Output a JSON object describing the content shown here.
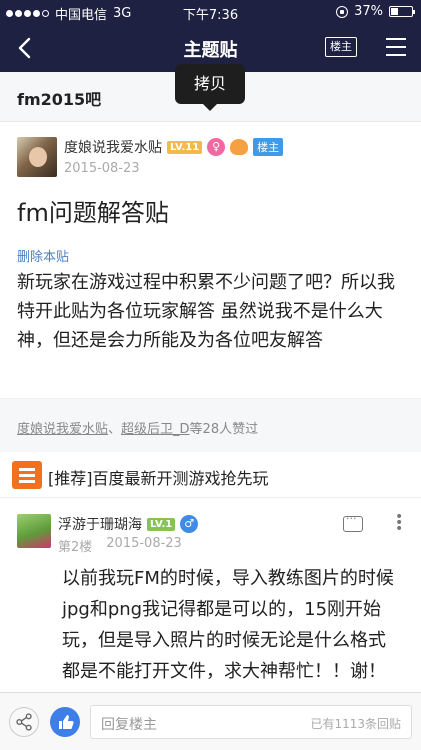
{
  "status_bar": {
    "carrier": "中国电信",
    "network": "3G",
    "time": "下午7:36",
    "battery_text": "37%",
    "battery_level": 0.37
  },
  "nav": {
    "title": "主题贴",
    "owner_only_label": "楼主",
    "back_icon": "back-arrow-icon",
    "menu_icon": "hamburger-menu-icon"
  },
  "tooltip": {
    "label": "拷贝"
  },
  "forum": {
    "name": "fm2015吧"
  },
  "post": {
    "author": "度娘说我爱水贴",
    "level": "LV.11",
    "gender_icon": "♀",
    "owner_tag": "楼主",
    "date": "2015-08-23",
    "title": "fm问题解答贴",
    "delete_link": "删除本贴",
    "body": "新玩家在游戏过程中积累不少问题了吧？所以我特开此贴为各位玩家解答 虽然说我不是什么大神，但还是会力所能及为各位吧友解答"
  },
  "likes": {
    "user1": "度娘说我爱水贴",
    "separator": "、",
    "user2": "超级后卫_D",
    "suffix": "等28人赞过"
  },
  "promo": {
    "text": "[推荐]百度最新开测游戏抢先玩"
  },
  "reply": {
    "author": "浮游于珊瑚海",
    "level": "LV.1",
    "gender_icon": "♂",
    "floor": "第2楼",
    "date": "2015-08-23",
    "body": "以前我玩FM的时候，导入教练图片的时候jpg和png我记得都是可以的，15刚开始玩，但是导入照片的时候无论是什么格式都是不能打开文件，求大神帮忙！！谢！"
  },
  "bottom_bar": {
    "placeholder": "回复楼主",
    "reply_count": "已有1113条回贴"
  },
  "colors": {
    "nav_bg": "#1e2142",
    "accent_blue": "#3d7fe6",
    "level_orange": "#f5b84c",
    "level_green": "#85c357",
    "promo_orange": "#f3701d"
  }
}
